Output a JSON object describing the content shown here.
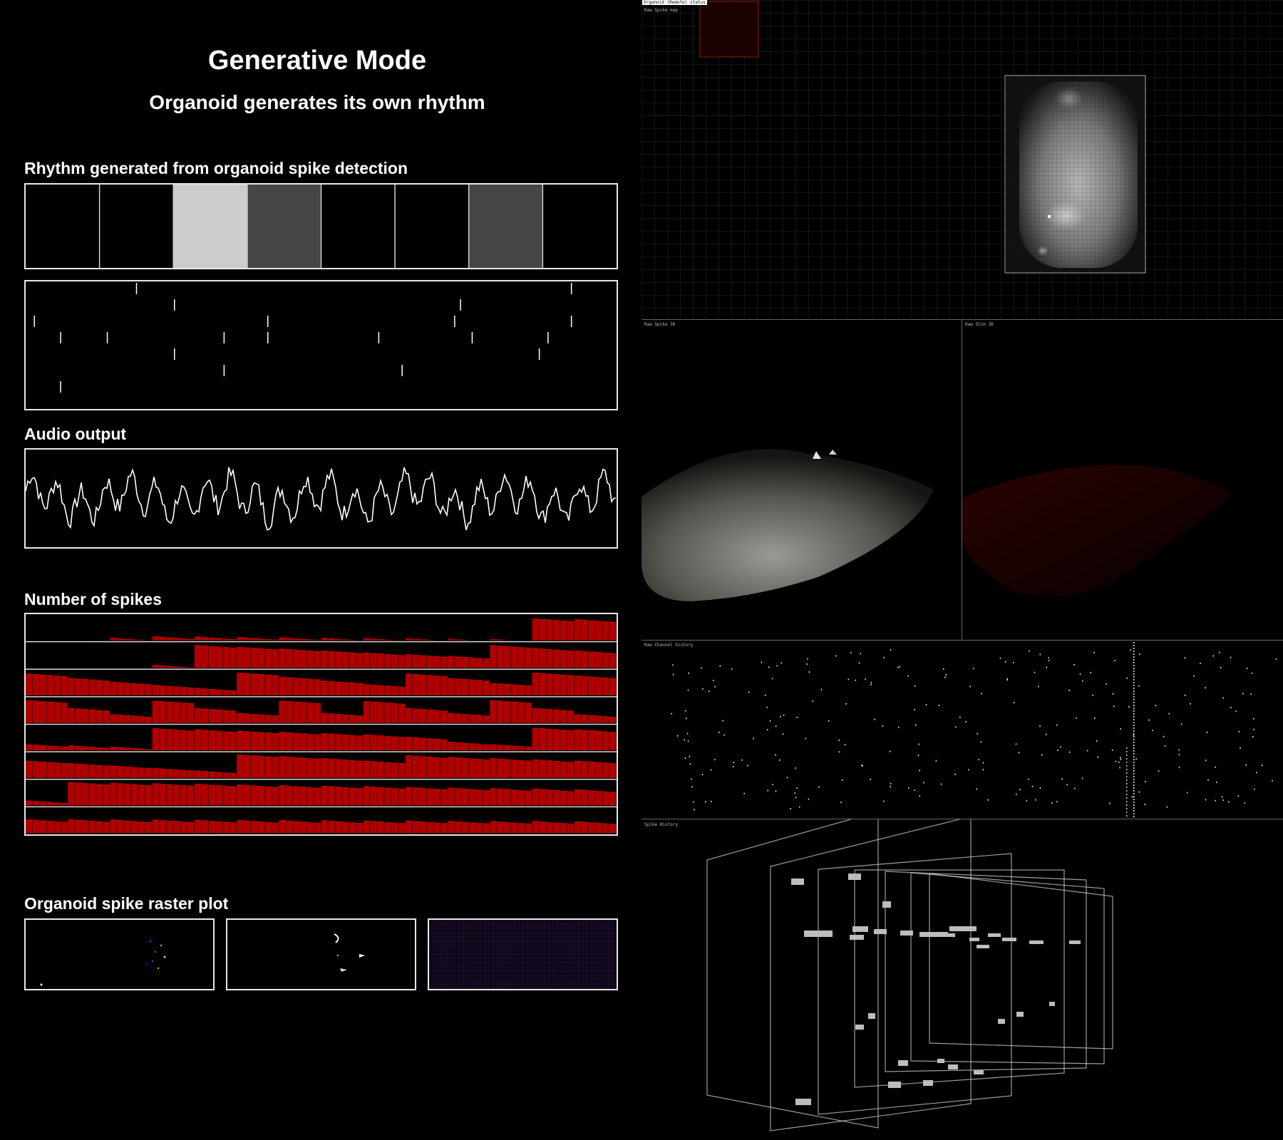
{
  "header": {
    "title": "Generative Mode",
    "subtitle": "Organoid generates its own rhythm"
  },
  "sections": {
    "rhythm": "Rhythm generated from organoid spike detection",
    "audio": "Audio output",
    "spikes": "Number of spikes",
    "raster": "Organoid spike raster plot"
  },
  "rhythm_steps": [
    0,
    0,
    0.8,
    0.27,
    0,
    0,
    0.27,
    0
  ],
  "spike_ticks": [
    {
      "x": 0.185,
      "r": 0
    },
    {
      "x": 0.93,
      "r": 0
    },
    {
      "x": 0.25,
      "r": 1
    },
    {
      "x": 0.74,
      "r": 1
    },
    {
      "x": 0.01,
      "r": 2
    },
    {
      "x": 0.41,
      "r": 2
    },
    {
      "x": 0.73,
      "r": 2
    },
    {
      "x": 0.93,
      "r": 2
    },
    {
      "x": 0.055,
      "r": 3
    },
    {
      "x": 0.135,
      "r": 3
    },
    {
      "x": 0.335,
      "r": 3
    },
    {
      "x": 0.41,
      "r": 3
    },
    {
      "x": 0.6,
      "r": 3
    },
    {
      "x": 0.76,
      "r": 3
    },
    {
      "x": 0.89,
      "r": 3
    },
    {
      "x": 0.25,
      "r": 4
    },
    {
      "x": 0.875,
      "r": 4
    },
    {
      "x": 0.335,
      "r": 5
    },
    {
      "x": 0.64,
      "r": 5
    },
    {
      "x": 0.055,
      "r": 6
    }
  ],
  "spike_rows": [
    [
      0,
      0,
      0.1,
      0.16,
      0.15,
      0.13,
      0.12,
      0.1,
      0.09,
      0.08,
      0.06,
      0.05,
      0.88,
      0.85
    ],
    [
      0,
      0,
      0,
      0.12,
      0.92,
      0.85,
      0.78,
      0.7,
      0.62,
      0.55,
      0.48,
      0.92,
      0.8,
      0.7
    ],
    [
      0.88,
      0.7,
      0.55,
      0.42,
      0.3,
      0.92,
      0.75,
      0.6,
      0.45,
      0.88,
      0.7,
      0.5,
      0.92,
      0.8
    ],
    [
      0.92,
      0.6,
      0.35,
      0.9,
      0.6,
      0.4,
      0.9,
      0.4,
      0.88,
      0.6,
      0.4,
      0.92,
      0.6,
      0.35
    ],
    [
      0.25,
      0.2,
      0.15,
      0.9,
      0.85,
      0.8,
      0.75,
      0.7,
      0.65,
      0.55,
      0.35,
      0.25,
      0.92,
      0.85
    ],
    [
      0.7,
      0.6,
      0.5,
      0.4,
      0.3,
      0.95,
      0.88,
      0.8,
      0.7,
      0.92,
      0.85,
      0.8,
      0.75,
      0.7
    ],
    [
      0.2,
      0.95,
      0.92,
      0.9,
      0.88,
      0.85,
      0.82,
      0.8,
      0.78,
      0.75,
      0.72,
      0.7,
      0.68,
      0.65
    ],
    [
      0.55,
      0.55,
      0.54,
      0.54,
      0.53,
      0.52,
      0.52,
      0.51,
      0.5,
      0.5,
      0.49,
      0.48,
      0.48,
      0.47
    ]
  ],
  "spike_color": "#b00000",
  "panels": {
    "remote_status": "Organoid (Remote) status",
    "spike_map": "Raw Spike map",
    "spike_3d": "Raw Spike 3D",
    "stim_3d": "Raw Stim 3D",
    "channel_history": "Raw Channel history",
    "spike_history": "Spike History"
  }
}
